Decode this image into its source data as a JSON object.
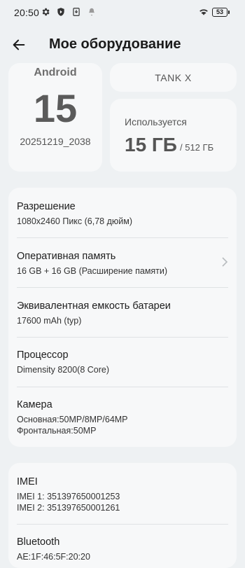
{
  "status_bar": {
    "time": "20:50",
    "battery": "53"
  },
  "header": {
    "title": "Мое оборудование"
  },
  "android": {
    "name": "Android",
    "version": "15",
    "build": "20251219_2038"
  },
  "model": {
    "name": "TANK X"
  },
  "storage": {
    "label": "Используется",
    "used": "15 ГБ",
    "total": "/ 512 ГБ"
  },
  "specs": [
    {
      "title": "Разрешение",
      "lines": [
        "1080x2460 Пикс (6,78 дюйм)"
      ]
    },
    {
      "title": "Оперативная память",
      "lines": [
        "16 GB + 16 GB (Расширение памяти)"
      ]
    },
    {
      "title": "Эквивалентная емкость батареи",
      "lines": [
        "17600 mAh (typ)"
      ]
    },
    {
      "title": "Процессор",
      "lines": [
        "Dimensity 8200(8 Core)"
      ]
    },
    {
      "title": "Камера",
      "lines": [
        "Основная:50MP/8MP/64MP",
        "Фронтальная:50MP"
      ]
    }
  ],
  "identifiers": [
    {
      "title": "IMEI",
      "lines": [
        "IMEI 1: 351397650001253",
        "IMEI 2: 351397650001261"
      ]
    },
    {
      "title": "Bluetooth",
      "lines": [
        "AE:1F:46:5F:20:20"
      ]
    }
  ],
  "icons": {
    "status": [
      "gear-icon",
      "shield-icon",
      "download-icon",
      "notification-icon",
      "wifi-icon"
    ],
    "back": "back-arrow-icon",
    "chevron": "chevron-right-icon"
  }
}
